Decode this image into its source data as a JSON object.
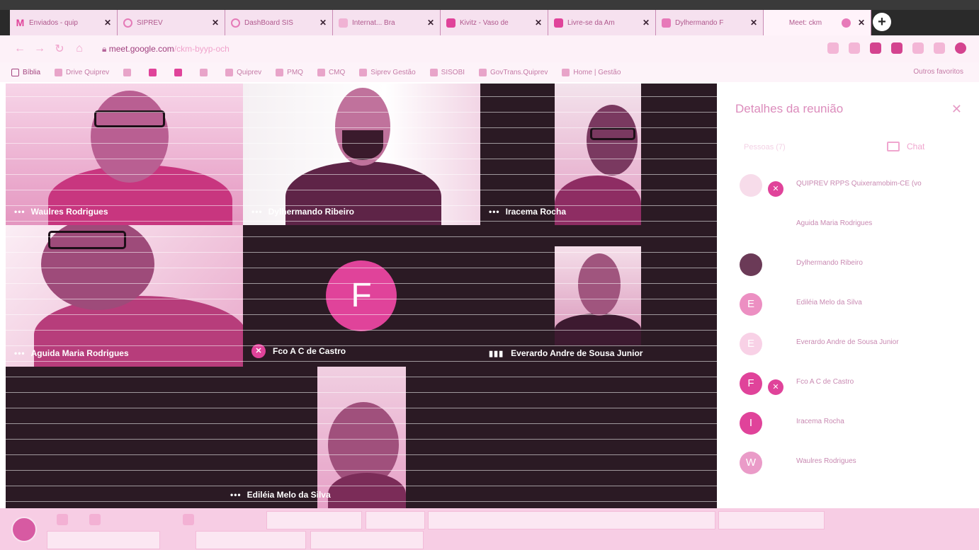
{
  "browser": {
    "tabs": [
      {
        "title": "Enviados - quip",
        "icon": "gmail-icon"
      },
      {
        "title": "SIPREV",
        "icon": "globe-icon"
      },
      {
        "title": "DashBoard SIS",
        "icon": "globe-icon"
      },
      {
        "title": "Internat... Bra",
        "icon": "link-icon"
      },
      {
        "title": "Kivitz - Vaso de",
        "icon": "youtube-icon"
      },
      {
        "title": "Livre-se da Am",
        "icon": "youtube-icon"
      },
      {
        "title": "Dylhermando F",
        "icon": "meet-icon"
      },
      {
        "title": "Meet: ckm",
        "icon": "meet-icon",
        "active": true
      }
    ],
    "new_tab": "+",
    "close_glyph": "✕",
    "url_host": "meet.google.com",
    "url_path": "/ckm-byyp-och",
    "bookmarks": [
      "Bíblia",
      "Drive Quiprev",
      "Quiprev",
      "PMQ",
      "CMQ",
      "Siprev Gestão",
      "SISOBI",
      "GovTrans.Quiprev",
      "Home | Gestão"
    ],
    "other_bookmarks": "Outros favoritos"
  },
  "meet": {
    "tiles": [
      {
        "name": "Waulres Rodrigues"
      },
      {
        "name": "Dylhermando Ribeiro"
      },
      {
        "name": "Iracema Rocha"
      },
      {
        "name": "Aguida Maria Rodrigues"
      },
      {
        "name": "Fco A C de Castro",
        "avatar": "F"
      },
      {
        "name": "Everardo Andre de Sousa Junior"
      },
      {
        "name": "Ediléia Melo da Silva"
      }
    ],
    "panel": {
      "title": "Detalhes da reunião",
      "people_tab": "Pessoas (7)",
      "chat_tab": "Chat",
      "participants": [
        {
          "name": "QUIPREV RPPS Quixeramobim-CE (vo",
          "avatar": "",
          "muted": true
        },
        {
          "name": "Aguida Maria Rodrigues",
          "avatar": ""
        },
        {
          "name": "Dylhermando Ribeiro",
          "avatar": ""
        },
        {
          "name": "Ediléia Melo da Silva",
          "avatar": "E"
        },
        {
          "name": "Everardo Andre de Sousa Junior",
          "avatar": "E"
        },
        {
          "name": "Fco A C de Castro",
          "avatar": "F",
          "muted": true
        },
        {
          "name": "Iracema Rocha",
          "avatar": "I"
        },
        {
          "name": "Waulres Rodrigues",
          "avatar": "W"
        }
      ]
    }
  },
  "colors": {
    "accent": "#e0439a",
    "tint": "#f3b6d6",
    "dark": "#2b1a24"
  }
}
